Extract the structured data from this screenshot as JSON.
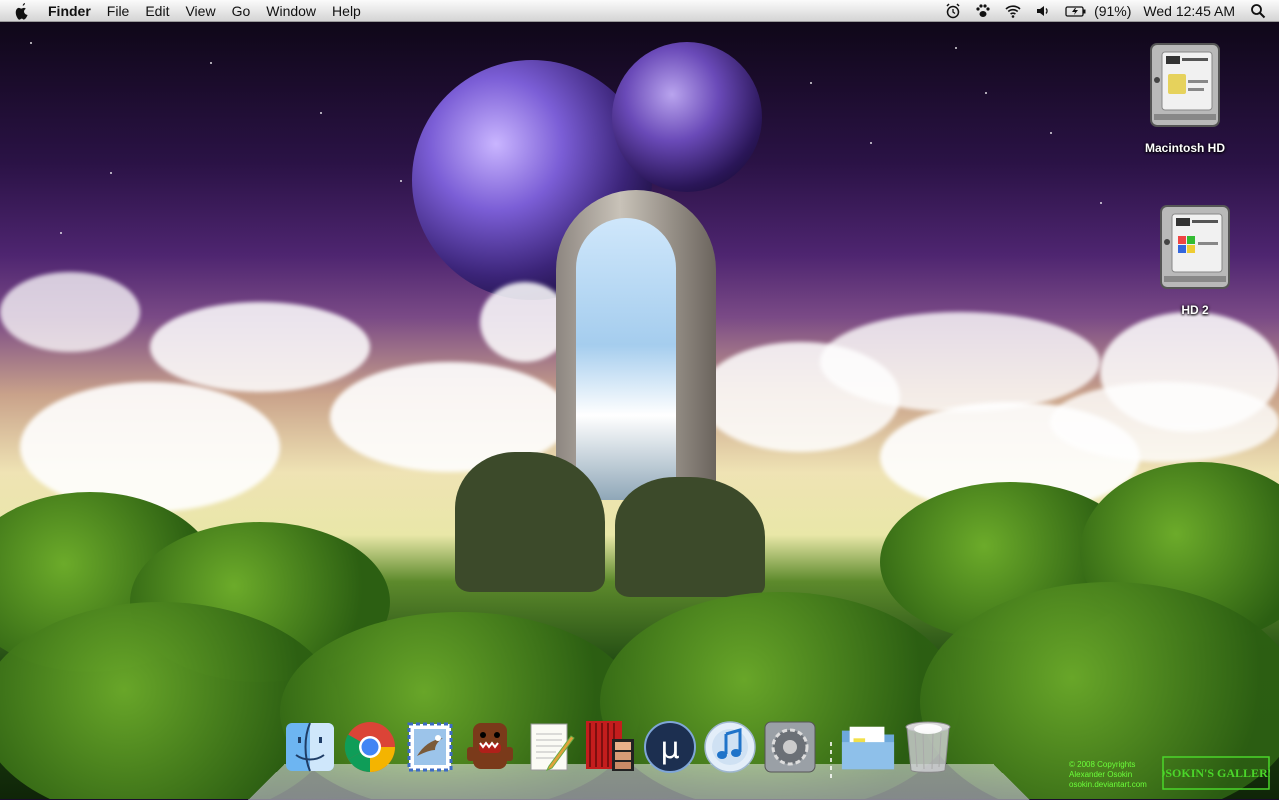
{
  "menubar": {
    "app_name": "Finder",
    "menus": [
      "File",
      "Edit",
      "View",
      "Go",
      "Window",
      "Help"
    ],
    "battery_text": "(91%)",
    "clock": "Wed 12:45 AM"
  },
  "desktop": {
    "icons": [
      {
        "label": "Macintosh HD",
        "icon": "hard-drive-mac-icon"
      },
      {
        "label": "HD 2",
        "icon": "hard-drive-windows-icon"
      }
    ]
  },
  "dock": {
    "apps": [
      {
        "name": "Finder",
        "icon": "finder-icon"
      },
      {
        "name": "Google Chrome",
        "icon": "chrome-icon"
      },
      {
        "name": "Mail",
        "icon": "mail-icon"
      },
      {
        "name": "Domo",
        "icon": "domo-icon"
      },
      {
        "name": "TextEdit",
        "icon": "textedit-icon"
      },
      {
        "name": "Photo Booth",
        "icon": "photo-booth-icon"
      },
      {
        "name": "uTorrent",
        "icon": "utorrent-icon"
      },
      {
        "name": "iTunes",
        "icon": "itunes-icon"
      },
      {
        "name": "System Preferences",
        "icon": "system-preferences-icon"
      },
      {
        "name": "Documents",
        "icon": "documents-folder-icon"
      },
      {
        "name": "Trash",
        "icon": "trash-icon"
      }
    ]
  },
  "credits": {
    "line1": "© 2008 Copyrights",
    "line2": "Alexander Osokin",
    "line3": "osokin.deviantart.com",
    "logo_text": "OSOKIN'S GALLERY"
  },
  "colors": {
    "menubar": "#e6e6e6",
    "credit_text": "#6bff3a"
  }
}
